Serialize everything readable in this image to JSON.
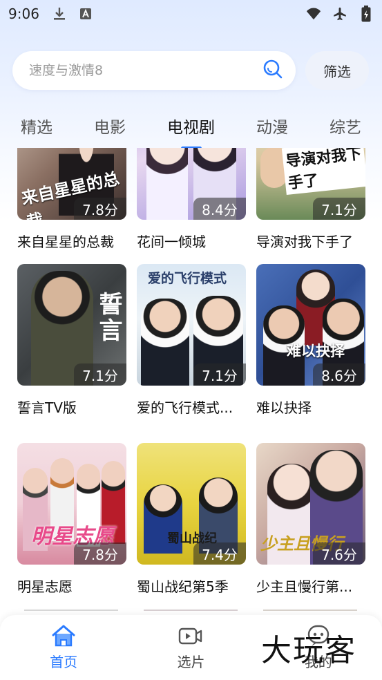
{
  "status_bar": {
    "time": "9:06"
  },
  "search": {
    "placeholder": "速度与激情8",
    "filter_label": "筛选"
  },
  "tabs": [
    {
      "label": "精选"
    },
    {
      "label": "电影"
    },
    {
      "label": "电视剧"
    },
    {
      "label": "动漫"
    },
    {
      "label": "综艺"
    }
  ],
  "active_tab": "电视剧",
  "cards": [
    {
      "title": "来自星星的总裁",
      "rating": "7.8分"
    },
    {
      "title": "花间一倾城",
      "rating": "8.4分"
    },
    {
      "title": "导演对我下手了",
      "rating": "7.1分"
    },
    {
      "title": "誓言TV版",
      "rating": "7.1分"
    },
    {
      "title": "爱的飞行模式...",
      "rating": "7.1分"
    },
    {
      "title": "难以抉择",
      "rating": "8.6分"
    },
    {
      "title": "明星志愿",
      "rating": "7.8分"
    },
    {
      "title": "蜀山战纪第5季",
      "rating": "7.4分"
    },
    {
      "title": "少主且慢行第...",
      "rating": "7.6分"
    }
  ],
  "poster_text": {
    "card1": "来自星星的总裁",
    "card3": "导演对我下手了",
    "card4": "誓言",
    "card5": "爱的飞行模式",
    "card6": "难以抉择",
    "card7": "明星志愿",
    "card8": "蜀山战纪",
    "card9": "少主且慢行"
  },
  "bottom_nav": [
    {
      "label": "首页",
      "icon": "home-icon"
    },
    {
      "label": "选片",
      "icon": "video-icon"
    },
    {
      "label": "我的",
      "icon": "profile-icon"
    }
  ],
  "watermark": "大玩客",
  "colors": {
    "accent": "#2b7bff"
  }
}
